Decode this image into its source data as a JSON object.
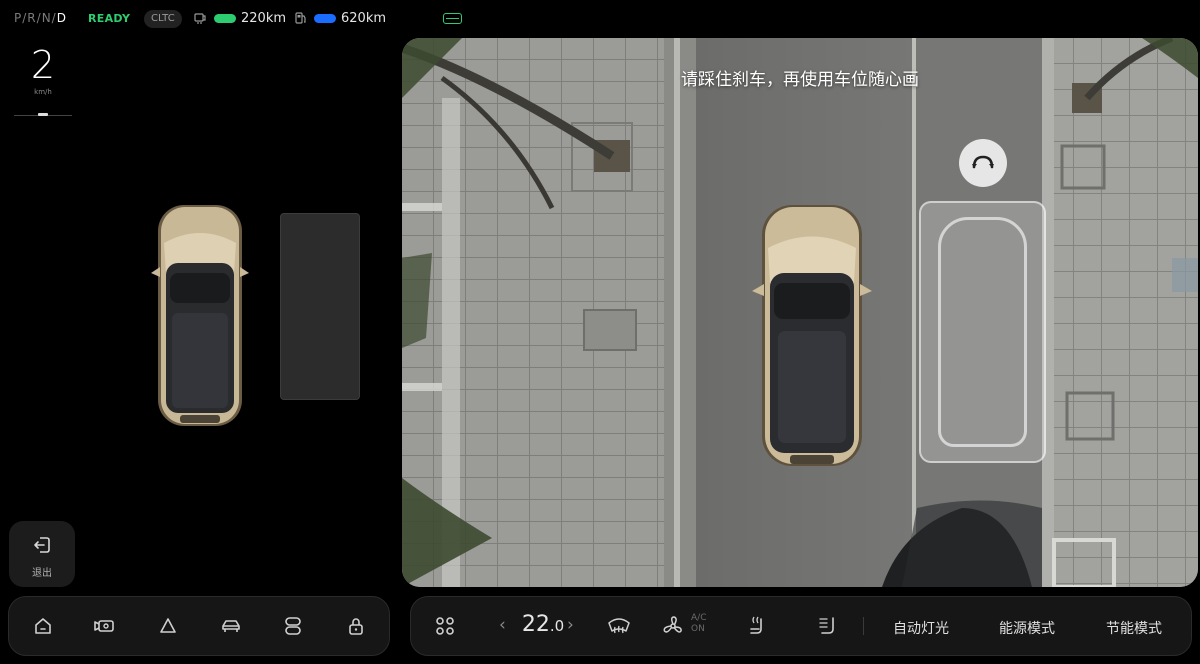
{
  "status_bar": {
    "gears": [
      "P",
      "R",
      "N",
      "D"
    ],
    "active_gear": "D",
    "ready_label": "READY",
    "cycle_badge": "CLTC",
    "electric_range": "220km",
    "fuel_range": "620km",
    "colors": {
      "ready": "#2ecc71",
      "electric": "#2ecc71",
      "fuel": "#1a6dff"
    }
  },
  "speedometer": {
    "value": "2",
    "unit": "km/h"
  },
  "exit_button": {
    "label": "退出"
  },
  "camera_view": {
    "message": "请踩住刹车，再使用车位随心画"
  },
  "left_dock": {
    "items": [
      "home-icon",
      "camera-icon",
      "hazard-icon",
      "car-icon",
      "mirror-icon",
      "lock-icon"
    ]
  },
  "climate": {
    "temperature_int": "22",
    "temperature_dec": ".0",
    "ac_label_top": "A/C",
    "ac_label_bottom": "ON"
  },
  "right_dock": {
    "auto_lights": "自动灯光",
    "energy_mode": "能源模式",
    "eco_mode": "节能模式"
  }
}
